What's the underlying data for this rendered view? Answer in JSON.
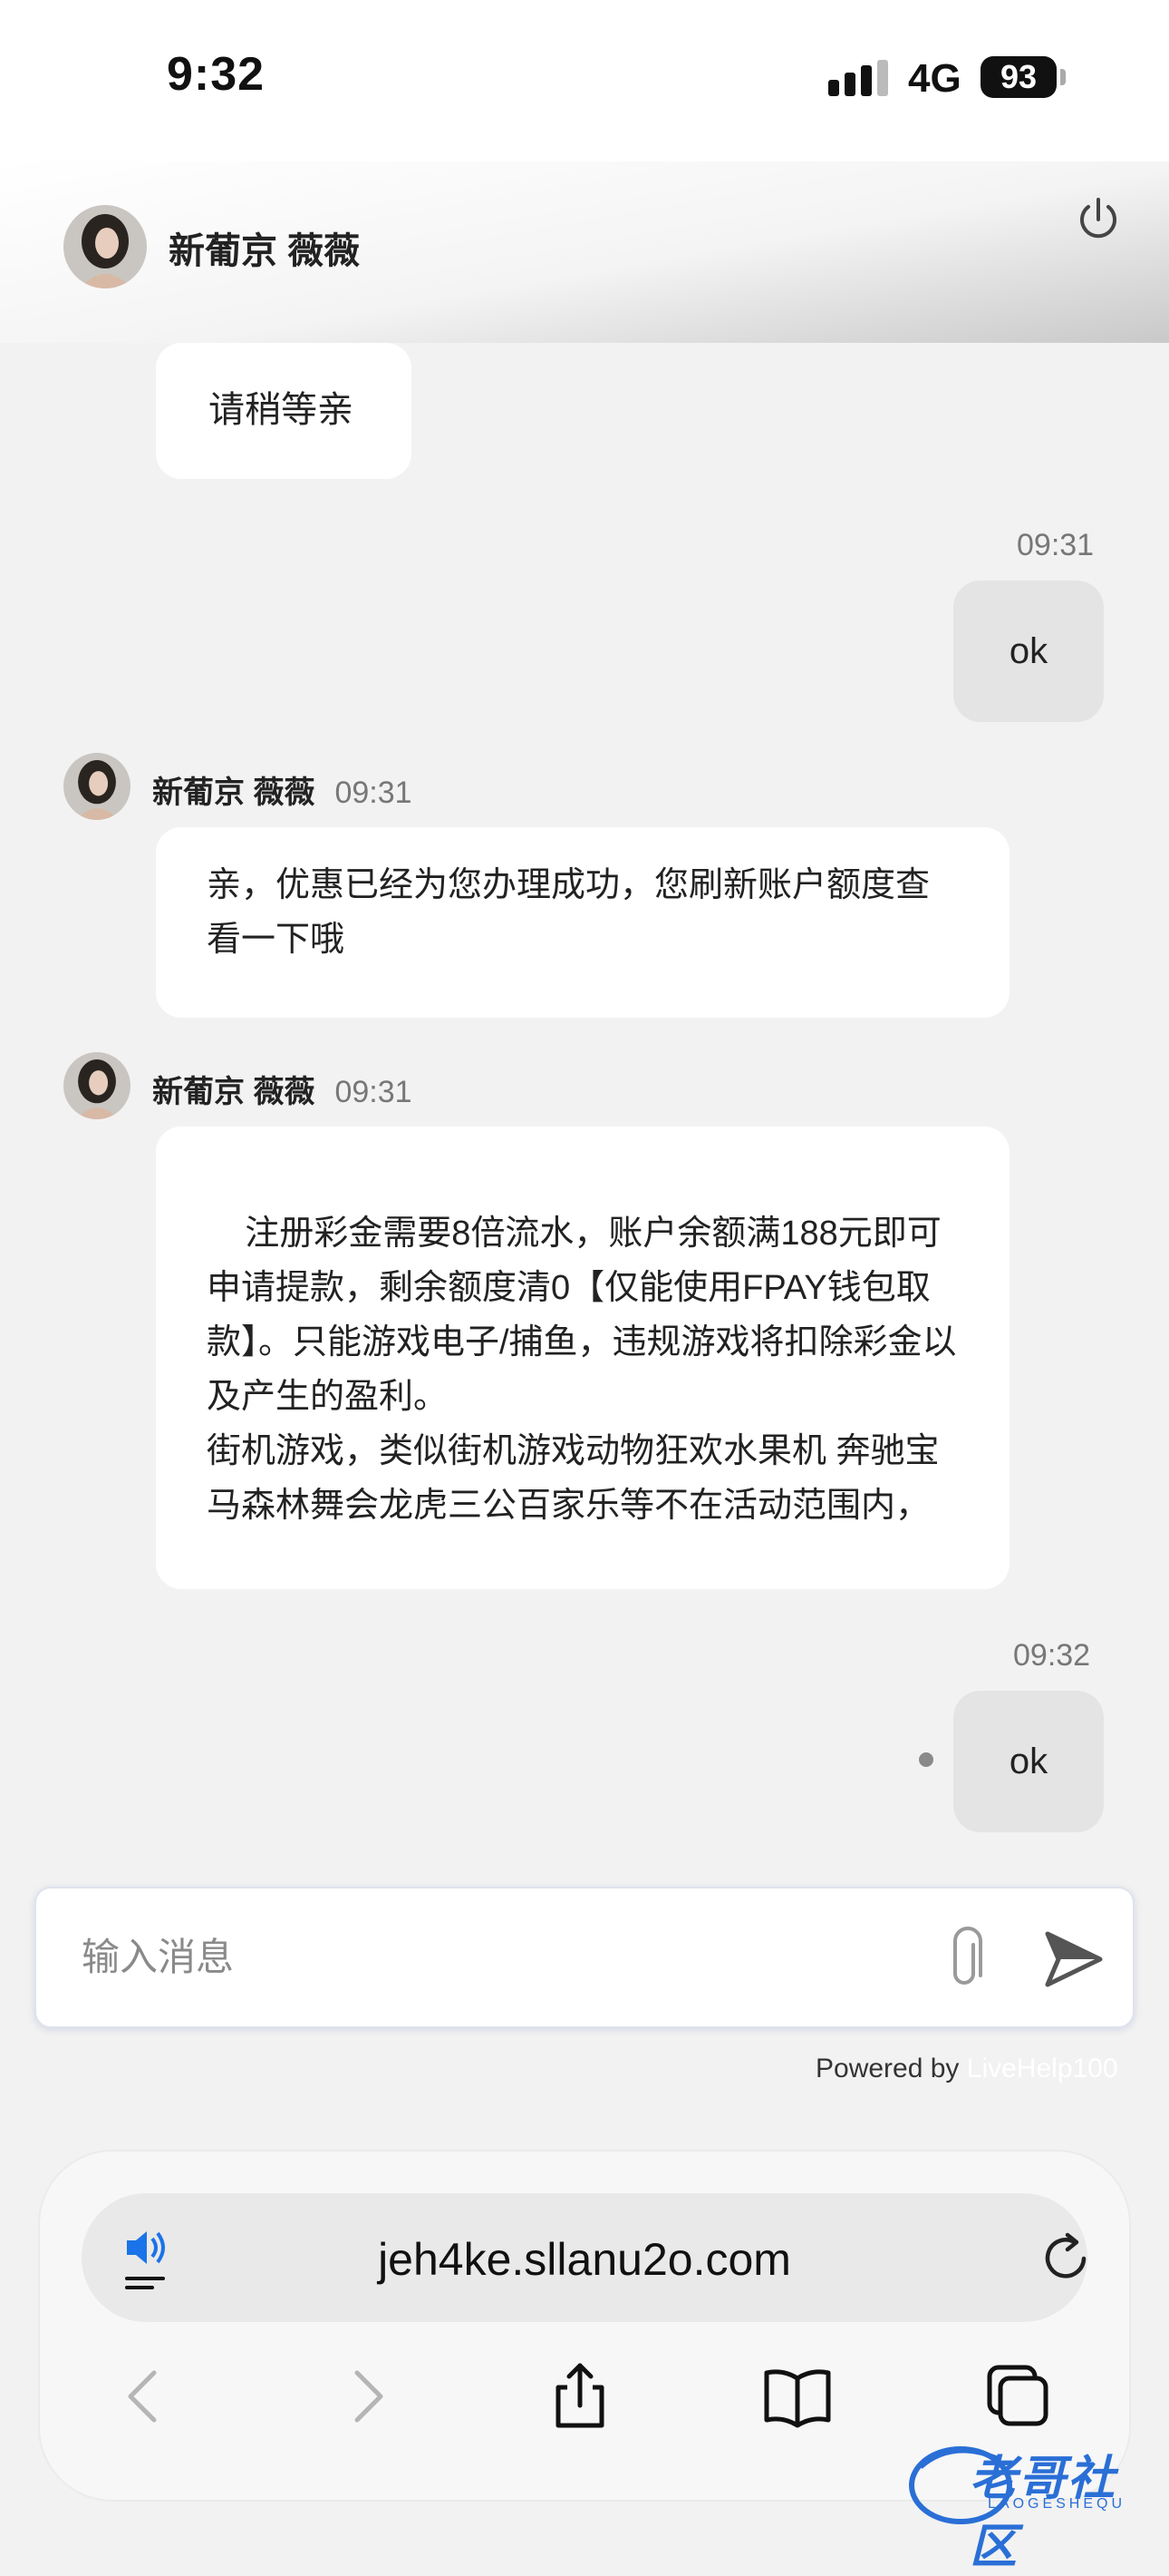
{
  "status_bar": {
    "time": "9:32",
    "network": "4G",
    "battery": "93"
  },
  "header": {
    "name": "新葡京 薇薇"
  },
  "messages": {
    "m1": {
      "text": "请稍等亲"
    },
    "m2": {
      "time": "09:31",
      "text": "ok"
    },
    "m3": {
      "name": "新葡京 薇薇",
      "time": "09:31",
      "text": "亲，优惠已经为您办理成功，您刷新账户额度查看一下哦"
    },
    "m4": {
      "name": "新葡京 薇薇",
      "time": "09:31",
      "text": "注册彩金需要8倍流水，账户余额满188元即可申请提款，剩余额度清0【仅能使用FPAY钱包取款】。只能游戏电子/捕鱼，违规游戏将扣除彩金以及产生的盈利。\n街机游戏，类似街机游戏动物狂欢水果机 奔驰宝马森林舞会龙虎三公百家乐等不在活动范围内，"
    },
    "m5": {
      "time": "09:32",
      "text": "ok"
    }
  },
  "input": {
    "placeholder": "输入消息"
  },
  "powered": {
    "prefix": "Powered by ",
    "brand": "LiveHelp100"
  },
  "browser": {
    "url": "jeh4ke.sllanu2o.com"
  },
  "watermark": {
    "text": "老哥社区",
    "sub": "LAOGESHEQU"
  },
  "icons": {
    "power": "power-icon",
    "attach": "paperclip-icon",
    "send": "send-icon",
    "speaker": "speaker-icon",
    "reload": "reload-icon",
    "back": "back-icon",
    "forward": "forward-icon",
    "share": "share-icon",
    "bookmarks": "bookmarks-icon",
    "tabs": "tabs-icon"
  },
  "colors": {
    "page_bg": "#f2f2f2",
    "bubble_in": "#ffffff",
    "bubble_out": "#e4e4e4",
    "watermark": "#2a6fd6"
  }
}
